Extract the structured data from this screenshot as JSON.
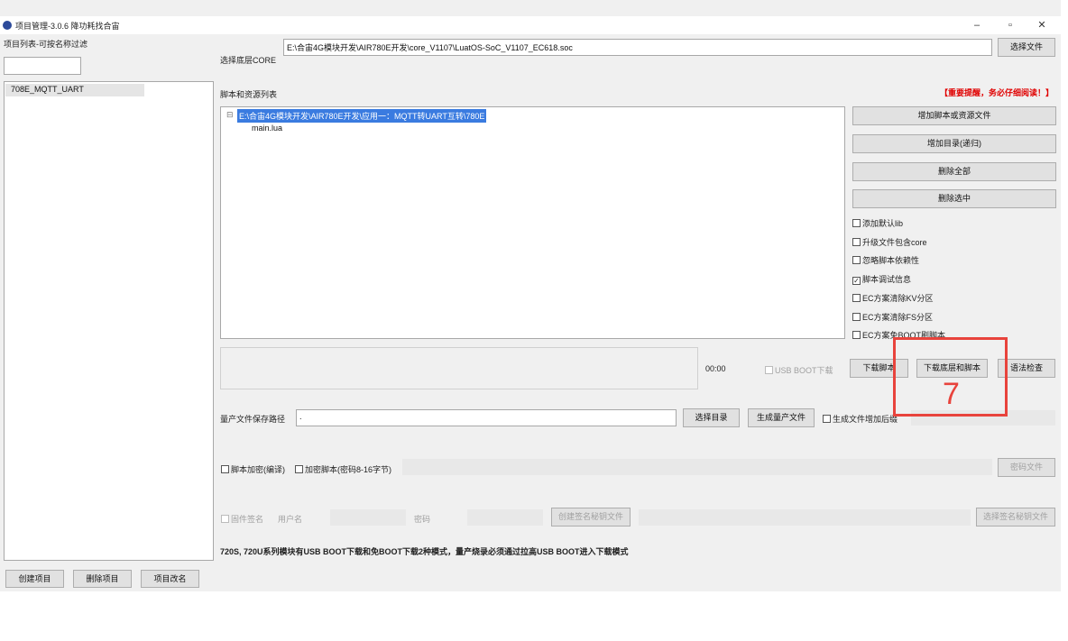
{
  "window": {
    "title": "项目管理-3.0.6 降功耗找合宙",
    "minimize_icon": "minimize-icon",
    "maximize_icon": "maximize-icon",
    "close_icon": "close-icon",
    "min_glyph": "–",
    "max_glyph": "▫",
    "close_glyph": "✕"
  },
  "left": {
    "filter_label": "项目列表-可按名称过滤",
    "filter_value": "",
    "projects": [
      "708E_MQTT_UART"
    ],
    "create_button": "创建项目",
    "delete_button": "删除项目",
    "rename_button": "项目改名"
  },
  "core": {
    "label": "选择底层CORE",
    "path": "E:\\合宙4G模块开发\\AIR780E开发\\core_V1107\\LuatOS-SoC_V1107_EC618.soc",
    "choose_button": "选择文件"
  },
  "scripts": {
    "label": "脚本和资源列表",
    "warning": "【重要提醒，务必仔细阅读！】",
    "tree_root": "E:\\合宙4G模块开发\\AIR780E开发\\应用一：MQTT转UART互转\\780E",
    "tree_toggle": "⊟",
    "tree_child": "main.lua",
    "add_files_button": "增加脚本或资源文件",
    "add_dir_button": "增加目录(递归)",
    "delete_all_button": "删除全部",
    "delete_selected_button": "删除选中"
  },
  "options": [
    {
      "label": "添加默认lib",
      "checked": false
    },
    {
      "label": "升级文件包含core",
      "checked": false
    },
    {
      "label": "忽略脚本依赖性",
      "checked": false
    },
    {
      "label": "脚本调试信息",
      "checked": true
    },
    {
      "label": "EC方案清除KV分区",
      "checked": false
    },
    {
      "label": "EC方案清除FS分区",
      "checked": false
    },
    {
      "label": "EC方案免BOOT刷脚本",
      "checked": false
    }
  ],
  "download": {
    "time": "00:00",
    "usb_boot_label": "USB BOOT下载",
    "download_script_button": "下载脚本",
    "download_core_script_button": "下载底层和脚本",
    "syntax_check_button": "语法检查"
  },
  "mass": {
    "save_path_label": "量产文件保存路径",
    "save_path_value": ".",
    "choose_dir_button": "选择目录",
    "generate_button": "生成量产文件",
    "append_time_label": "生成文件增加后缀"
  },
  "encrypt": {
    "script_encrypt_label": "脚本加密(编译)",
    "encrypt_script_label": "加密脚本(密码8-16字节)",
    "encrypt_button": "密码文件"
  },
  "firmware": {
    "sign_label": "固件签名",
    "username_label": "用户名",
    "password_label": "密码",
    "create_sign_button": "创建签名秘钥文件",
    "choose_sign_button": "选择签名秘钥文件"
  },
  "footer_note": "720S, 720U系列模块有USB BOOT下载和免BOOT下载2种模式，量产烧录必须通过拉高USB BOOT进入下载模式",
  "annotation": {
    "number": "7",
    "color": "#e8433c"
  }
}
